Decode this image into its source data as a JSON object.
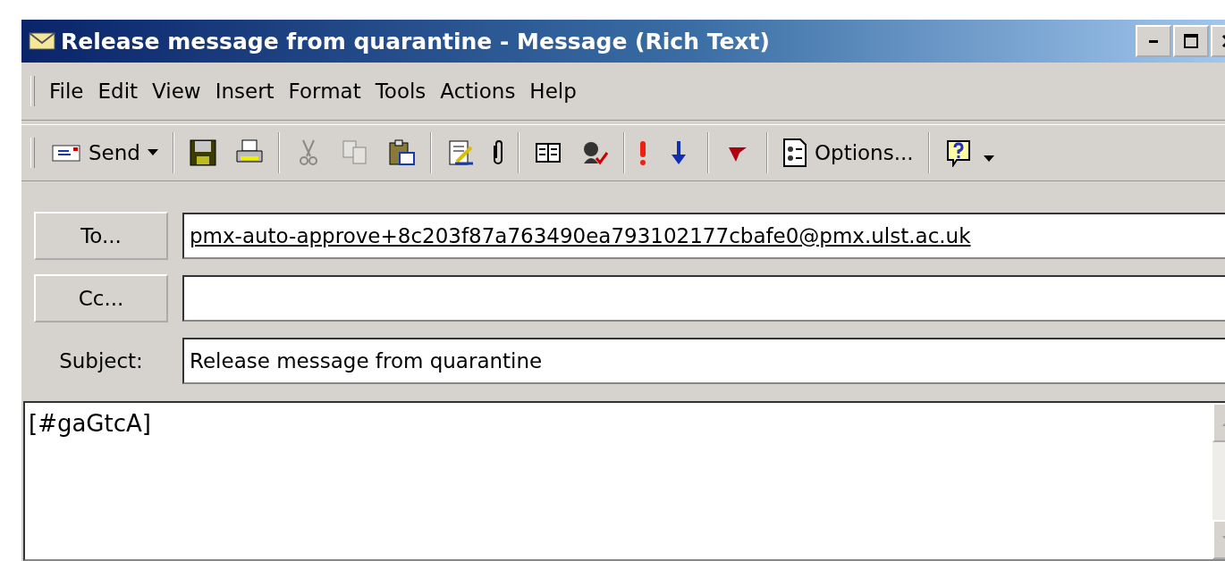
{
  "window": {
    "title": "Release message from quarantine - Message (Rich Text)"
  },
  "menu": [
    "File",
    "Edit",
    "View",
    "Insert",
    "Format",
    "Tools",
    "Actions",
    "Help"
  ],
  "toolbar": [
    [
      {
        "kind": "split",
        "label": "Send",
        "disabled": false
      }
    ],
    [
      {
        "kind": "icon",
        "disabled": false
      },
      {
        "kind": "icon",
        "disabled": false
      }
    ],
    [
      {
        "kind": "icon",
        "disabled": true
      },
      {
        "kind": "icon",
        "disabled": true
      },
      {
        "kind": "icon",
        "disabled": false
      }
    ],
    [
      {
        "kind": "icon",
        "disabled": false
      },
      {
        "kind": "icon",
        "disabled": false
      }
    ],
    [
      {
        "kind": "icon",
        "disabled": false
      },
      {
        "kind": "icon",
        "disabled": false
      }
    ],
    [
      {
        "kind": "icon",
        "disabled": false
      },
      {
        "kind": "icon",
        "disabled": false
      }
    ],
    [
      {
        "kind": "icon",
        "disabled": false
      }
    ],
    [
      {
        "kind": "text",
        "label": "Options...",
        "disabled": false
      }
    ],
    [
      {
        "kind": "icon",
        "disabled": false
      }
    ]
  ],
  "header_fields": [
    {
      "kind": "button",
      "label": "To...",
      "value": "pmx-auto-approve+8c203f87a763490ea793102177cbafe0@pmx.ulst.ac.uk",
      "resolved": true
    },
    {
      "kind": "button",
      "label": "Cc..."
    },
    {
      "kind": "label",
      "label": "Subject:",
      "value": "Release message from quarantine",
      "resolved": false
    }
  ],
  "body": {
    "text": "[#gaGtcA]"
  }
}
